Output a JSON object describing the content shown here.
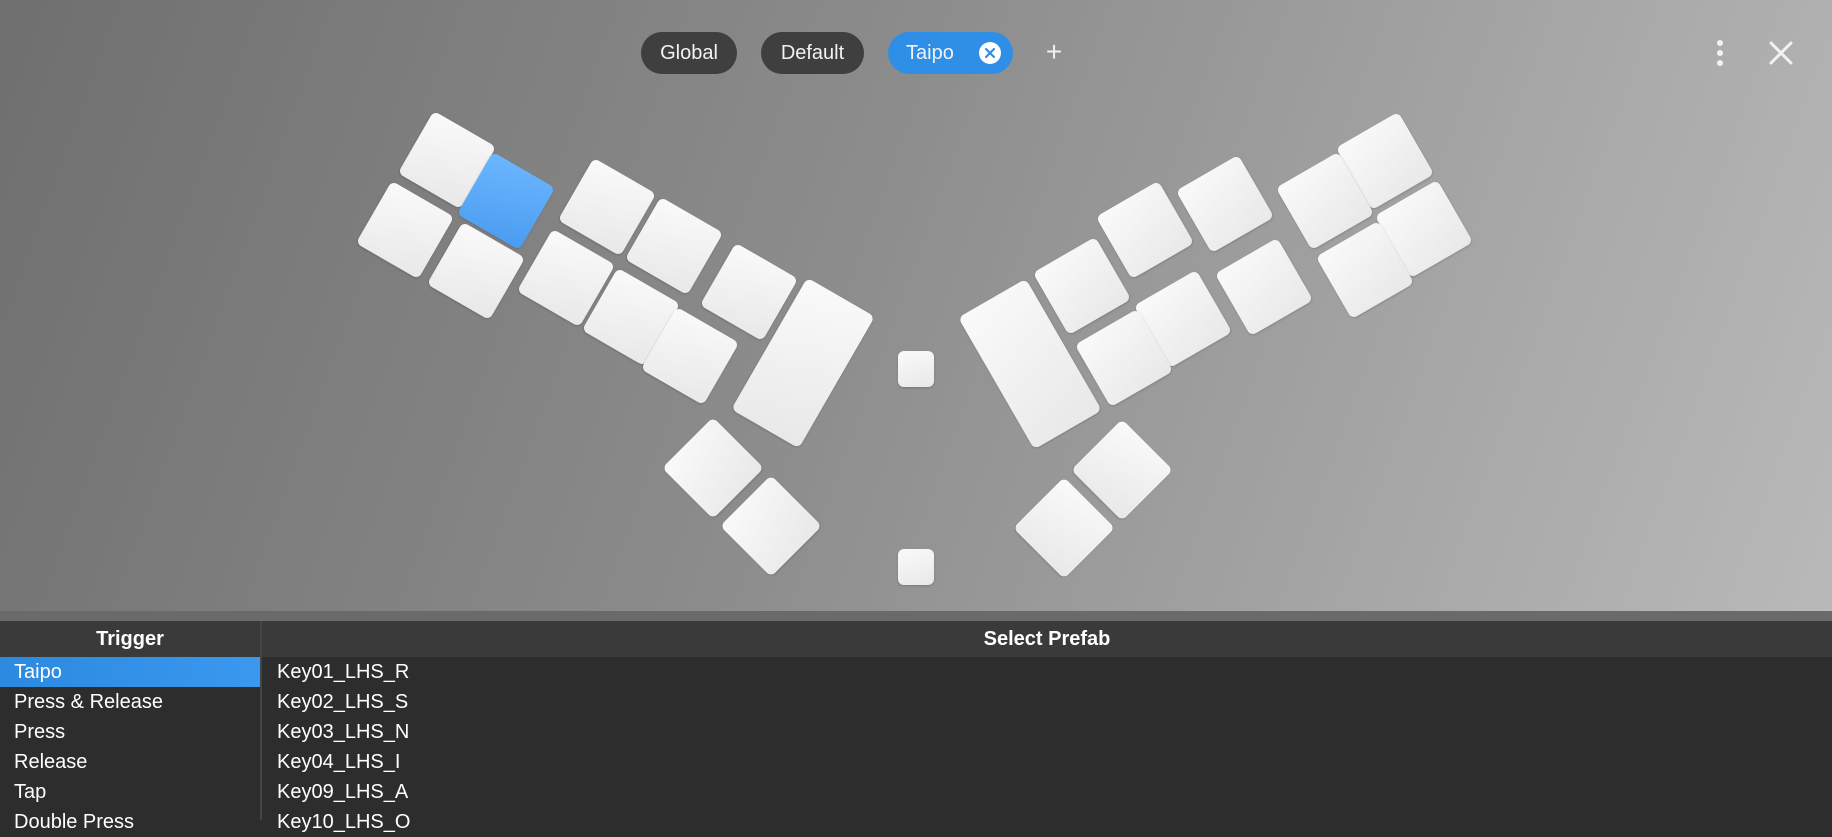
{
  "tabs": [
    {
      "label": "Global"
    },
    {
      "label": "Default"
    },
    {
      "label": "Taipo",
      "active": true
    }
  ],
  "add_tab_label": "+",
  "accent_color": "#2f8fe6",
  "keyboard": {
    "selected_key": "Key01_LHS_R"
  },
  "trigger_panel": {
    "header": "Trigger",
    "items": [
      "Taipo",
      "Press & Release",
      "Press",
      "Release",
      "Tap",
      "Double Press"
    ],
    "selected": "Taipo"
  },
  "prefab_panel": {
    "header": "Select Prefab",
    "items": [
      "Key01_LHS_R",
      "Key02_LHS_S",
      "Key03_LHS_N",
      "Key04_LHS_I",
      "Key09_LHS_A",
      "Key10_LHS_O"
    ]
  },
  "icons": {
    "tab_close": "close-circle-icon",
    "menu": "more-vertical-icon",
    "window_close": "close-icon"
  }
}
